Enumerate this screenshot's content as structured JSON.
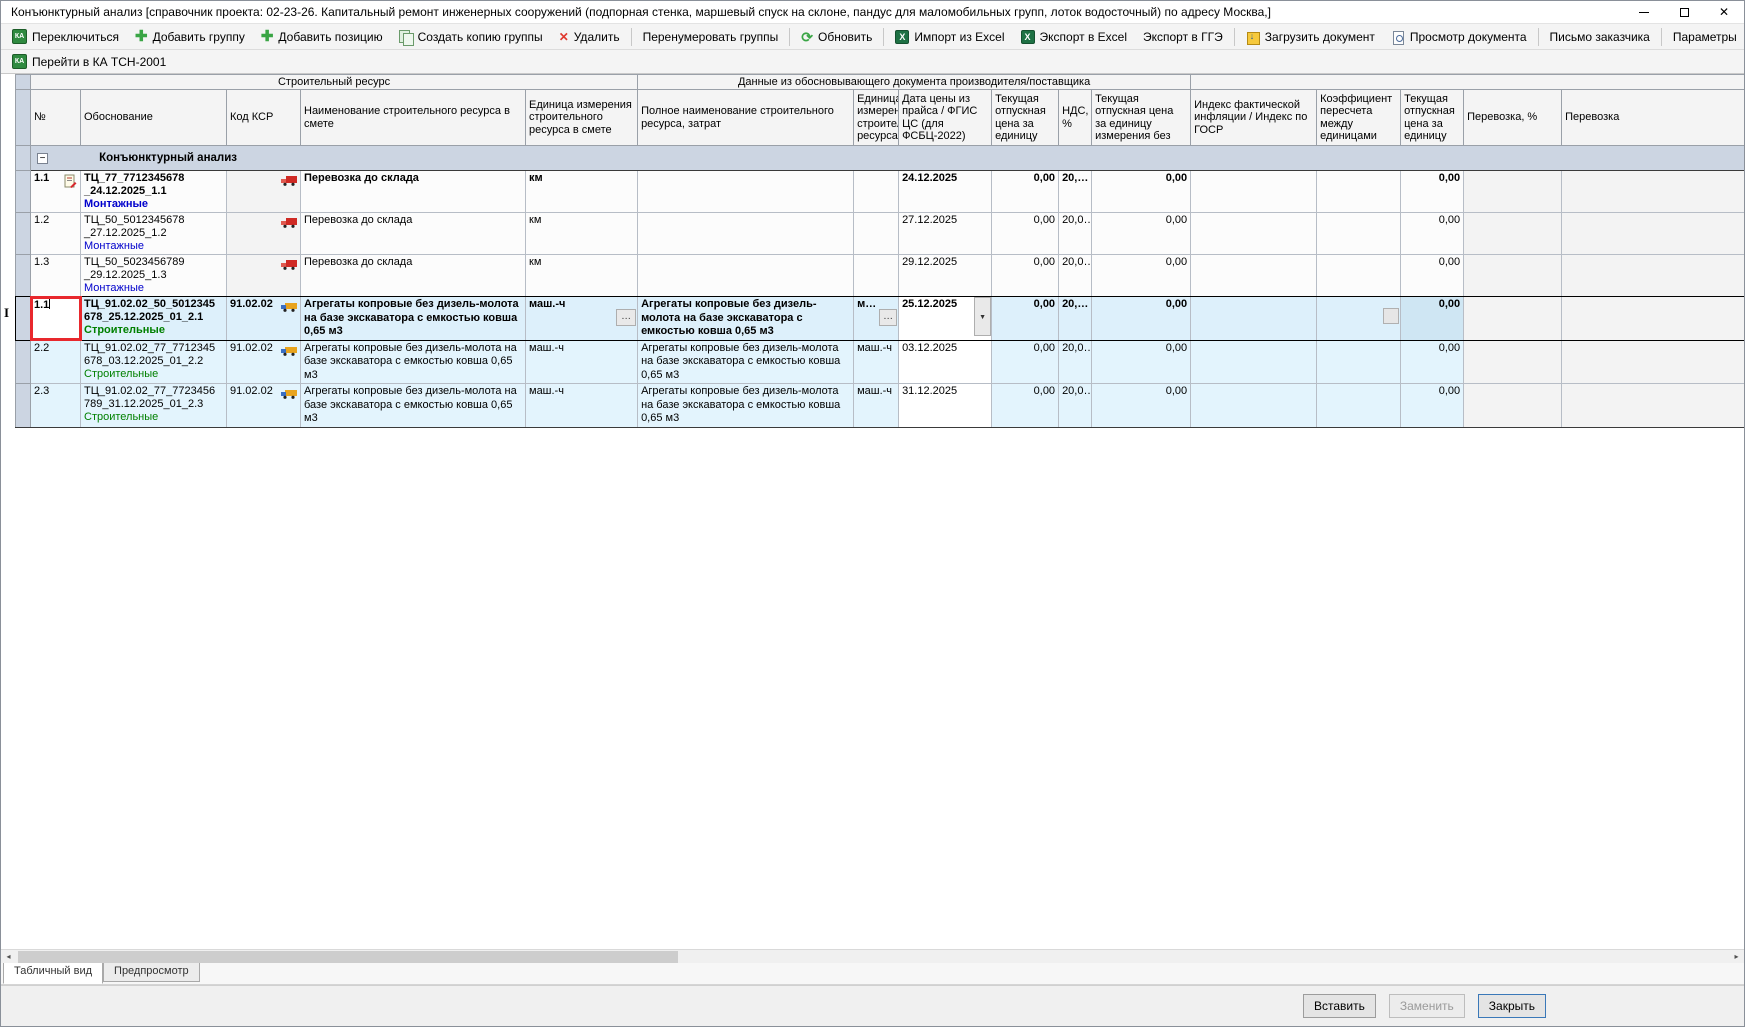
{
  "window": {
    "title": "Конъюнктурный анализ [справочник проекта: 02-23-26. Капитальный ремонт инженерных сооружений (подпорная стенка, маршевый спуск на склоне, пандус для маломобильных групп, лоток водосточный) по адресу Москва,]"
  },
  "toolbar": {
    "switch": "Переключиться",
    "add_group": "Добавить группу",
    "add_position": "Добавить позицию",
    "copy_group": "Создать копию группы",
    "delete": "Удалить",
    "renumber": "Перенумеровать группы",
    "refresh": "Обновить",
    "import_excel": "Импорт из Excel",
    "export_excel": "Экспорт в Excel",
    "export_gge": "Экспорт в ГГЭ",
    "load_doc": "Загрузить документ",
    "view_doc": "Просмотр документа",
    "customer_letter": "Письмо заказчика",
    "parameters": "Параметры",
    "goto_ka": "Перейти в КА ТСН-2001"
  },
  "grid": {
    "band1": "Строительный ресурс",
    "band2": "Данные из обосновывающего документа производителя/поставщика",
    "columns": [
      "№",
      "Обоснование",
      "Код КСР",
      "Наименование строительного ресурса в смете",
      "Единица измерения строительного ресурса в смете",
      "Полное наименование строительного ресурса, затрат",
      "Единица измерения строительного ресурса",
      "Дата цены из прайса / ФГИС ЦС (для ФСБЦ-2022)",
      "Текущая отпускная цена за единицу",
      "НДС, %",
      "Текущая отпускная цена за единицу измерения без",
      "Индекс фактической инфляции / Индекс по  ГОСР",
      "Коэффициент пересчета между единицами",
      "Текущая отпускная цена за единицу",
      "Перевозка, %",
      "Перевозка"
    ],
    "group_row": {
      "collapse": "−",
      "label": "Конъюнктурный анализ"
    },
    "rows": [
      {
        "num": "1.1",
        "obosn": "ТЦ_77_7712345678\n_24.12.2025_1.1",
        "category": "Монтажные",
        "code": "",
        "name": "Перевозка до склада",
        "unit": "км",
        "full_name": "",
        "unit2": "",
        "date": "24.12.2025",
        "price": "0,00",
        "vat": "20,…",
        "price_novat": "0,00",
        "price2": "0,00"
      },
      {
        "num": "1.2",
        "obosn": "ТЦ_50_5012345678\n_27.12.2025_1.2",
        "category": "Монтажные",
        "code": "",
        "name": "Перевозка до склада",
        "unit": "км",
        "full_name": "",
        "unit2": "",
        "date": "27.12.2025",
        "price": "0,00",
        "vat": "20,0…",
        "price_novat": "0,00",
        "price2": "0,00"
      },
      {
        "num": "1.3",
        "obosn": "ТЦ_50_5023456789\n_29.12.2025_1.3",
        "category": "Монтажные",
        "code": "",
        "name": "Перевозка до склада",
        "unit": "км",
        "full_name": "",
        "unit2": "",
        "date": "29.12.2025",
        "price": "0,00",
        "vat": "20,0…",
        "price_novat": "0,00",
        "price2": "0,00"
      },
      {
        "num": "1.1",
        "obosn": "ТЦ_91.02.02_50_5012345\n678_25.12.2025_01_2.1",
        "category": "Строительные",
        "code": "91.02.02",
        "name": "Агрегаты копровые без дизель-молота на базе экскаватора с емкостью ковша 0,65 м3",
        "unit": "маш.-ч",
        "full_name": "Агрегаты копровые без дизель-молота на базе экскаватора с емкостью ковша 0,65 м3",
        "unit2": "м…",
        "date": "25.12.2025",
        "price": "0,00",
        "vat": "20,…",
        "price_novat": "0,00",
        "price2": "0,00",
        "editor_ellipsis": "…",
        "combo_arrow": "▼"
      },
      {
        "num": "2.2",
        "obosn": "ТЦ_91.02.02_77_7712345\n678_03.12.2025_01_2.2",
        "category": "Строительные",
        "code": "91.02.02",
        "name": "Агрегаты копровые без дизель-молота на базе экскаватора с емкостью ковша 0,65 м3",
        "unit": "маш.-ч",
        "full_name": "Агрегаты копровые без дизель-молота на базе экскаватора с емкостью ковша 0,65 м3",
        "unit2": "маш.-ч",
        "date": "03.12.2025",
        "price": "0,00",
        "vat": "20,0…",
        "price_novat": "0,00",
        "price2": "0,00"
      },
      {
        "num": "2.3",
        "obosn": "ТЦ_91.02.02_77_7723456\n789_31.12.2025_01_2.3",
        "category": "Строительные",
        "code": "91.02.02",
        "name": "Агрегаты копровые без дизель-молота на базе экскаватора с емкостью ковша 0,65 м3",
        "unit": "маш.-ч",
        "full_name": "Агрегаты копровые без дизель-молота на базе экскаватора с емкостью ковша 0,65 м3",
        "unit2": "маш.-ч",
        "date": "31.12.2025",
        "price": "0,00",
        "vat": "20,0…",
        "price_novat": "0,00",
        "price2": "0,00"
      }
    ]
  },
  "footer": {
    "tabs": [
      "Табличный вид",
      "Предпросмотр"
    ],
    "insert": "Вставить",
    "replace": "Заменить",
    "close": "Закрыть"
  },
  "colors": {
    "category_montazh": "#0000cc",
    "category_stroit": "#008000",
    "edit_border": "#e8282d",
    "row2_background": "#e3f4fd",
    "group_row_background": "#ccd5e2"
  }
}
